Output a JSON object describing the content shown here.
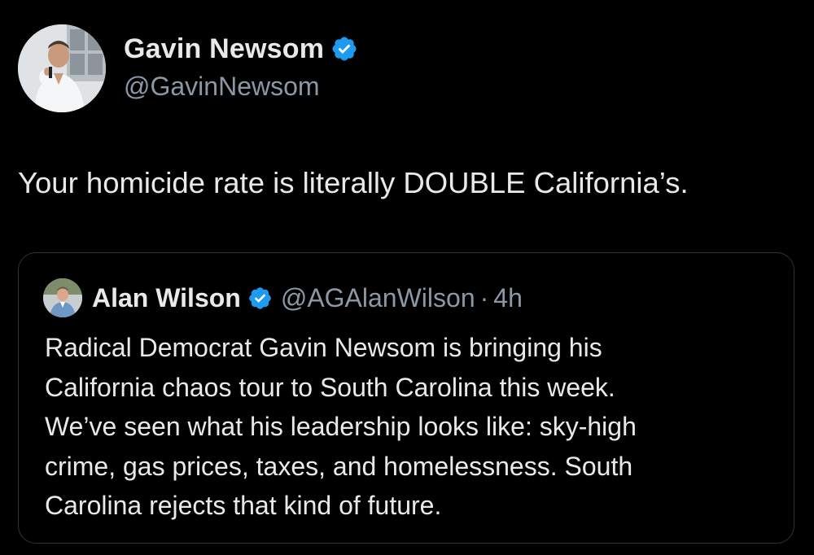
{
  "author": {
    "display_name": "Gavin Newsom",
    "handle": "@GavinNewsom",
    "verified": true
  },
  "tweet": {
    "text": "Your homicide rate is literally DOUBLE California’s."
  },
  "quote": {
    "author": {
      "display_name": "Alan Wilson",
      "handle": "@AGAlanWilson",
      "verified": true
    },
    "separator": "·",
    "time": "4h",
    "text_lines": [
      "Radical Democrat Gavin Newsom is bringing his",
      "California chaos tour to South Carolina this week.",
      "We’ve seen what his leadership looks like: sky-high",
      "crime, gas prices, taxes, and homelessness. South",
      "Carolina rejects that kind of future."
    ]
  },
  "colors": {
    "background": "#000000",
    "text_primary": "#e7e9ea",
    "text_secondary": "#8b98a5",
    "verified_badge": "#1d9bf0",
    "card_border": "#2f3336"
  },
  "icons": {
    "verified": "verified-badge-icon"
  }
}
